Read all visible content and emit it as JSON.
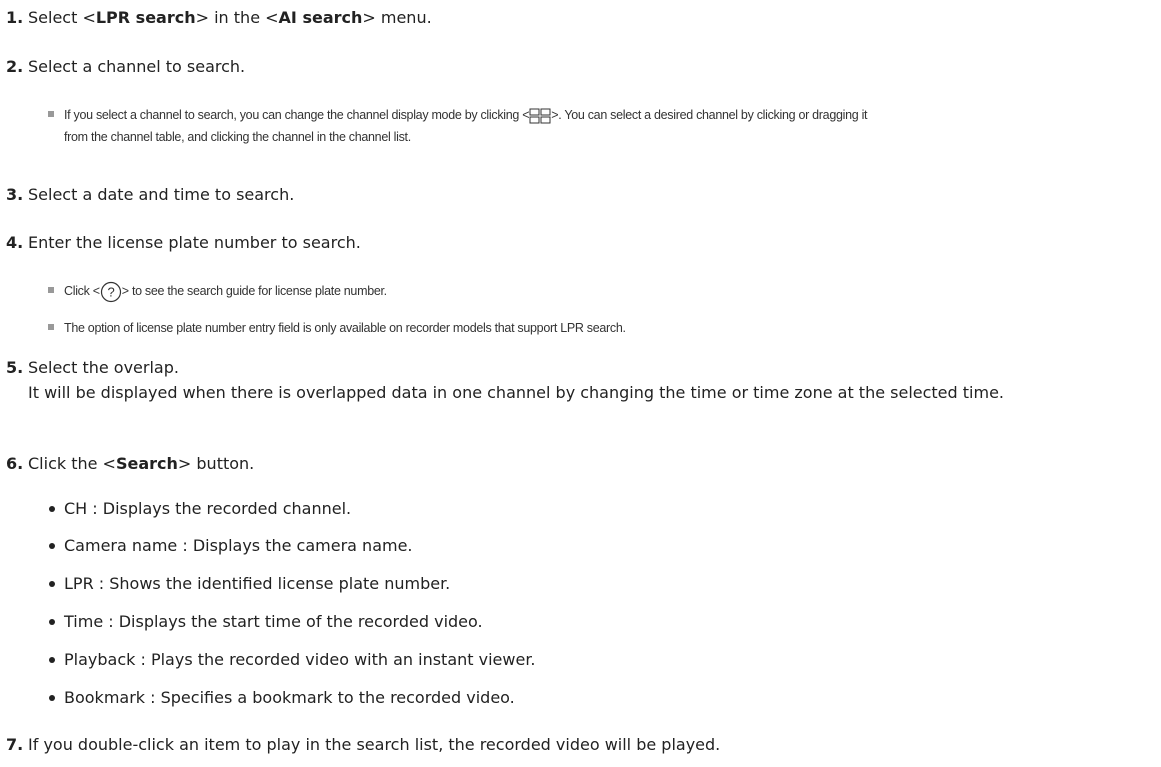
{
  "steps": [
    {
      "num": "1.",
      "p1": "Select <",
      "b1": "LPR search",
      "p2": "> in the <",
      "b2": "AI search",
      "p3": "> menu."
    },
    {
      "num": "2.",
      "text": "Select a channel to search."
    },
    {
      "num": "3.",
      "text": "Select a date and time to search."
    },
    {
      "num": "4.",
      "text": "Enter the license plate number to search."
    },
    {
      "num": "5.",
      "text": "Select the overlap.",
      "para": "It will be displayed when there is overlapped data in one channel by changing the time or time zone at the selected time."
    },
    {
      "num": "6.",
      "p1": "Click the <",
      "b1": "Search",
      "p2": "> button."
    },
    {
      "num": "7.",
      "text": "If you double-click an item to play in the search list, the recorded video will be played."
    }
  ],
  "notes": {
    "channel_mode": {
      "before": "If you select a channel to search, you can change the channel display mode by clicking <",
      "after": ">. You can select a desired channel by clicking or dragging it",
      "line2": "from the channel table, and clicking the channel in the channel list.",
      "icon": "grid-2x2-icon"
    },
    "help": {
      "before": "Click <",
      "after": "> to see the search guide for license plate number.",
      "icon": "question-circle-icon",
      "glyph": "?"
    },
    "availability": "The option of license plate number entry field is only available on recorder models that support LPR search."
  },
  "bullets": [
    "CH : Displays the recorded channel.",
    "Camera name : Displays the camera name.",
    "LPR : Shows the identified license plate number.",
    "Time : Displays the start time of the recorded video.",
    "Playback : Plays the recorded video with an instant viewer.",
    "Bookmark : Specifies a bookmark to the recorded video."
  ]
}
